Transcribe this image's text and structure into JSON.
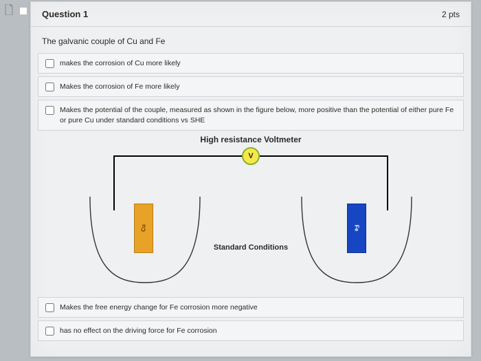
{
  "question": {
    "number_label": "Question 1",
    "points_label": "2 pts",
    "prompt": "The galvanic couple of Cu and Fe"
  },
  "options": [
    {
      "text": "makes the corrosion of Cu more likely"
    },
    {
      "text": "Makes the corrosion of Fe more likely"
    },
    {
      "text": "Makes the potential of the couple, measured as shown in the figure below, more positive than the potential of either pure Fe or pure Cu under standard conditions vs SHE"
    },
    {
      "text": "Makes the free energy change for Fe corrosion more negative"
    },
    {
      "text": "has no effect on the driving force for Fe corrosion"
    }
  ],
  "figure": {
    "title": "High resistance Voltmeter",
    "meter_label": "V",
    "conditions_label": "Standard Conditions",
    "left_electrode": "Cu",
    "right_electrode": "Fe"
  }
}
